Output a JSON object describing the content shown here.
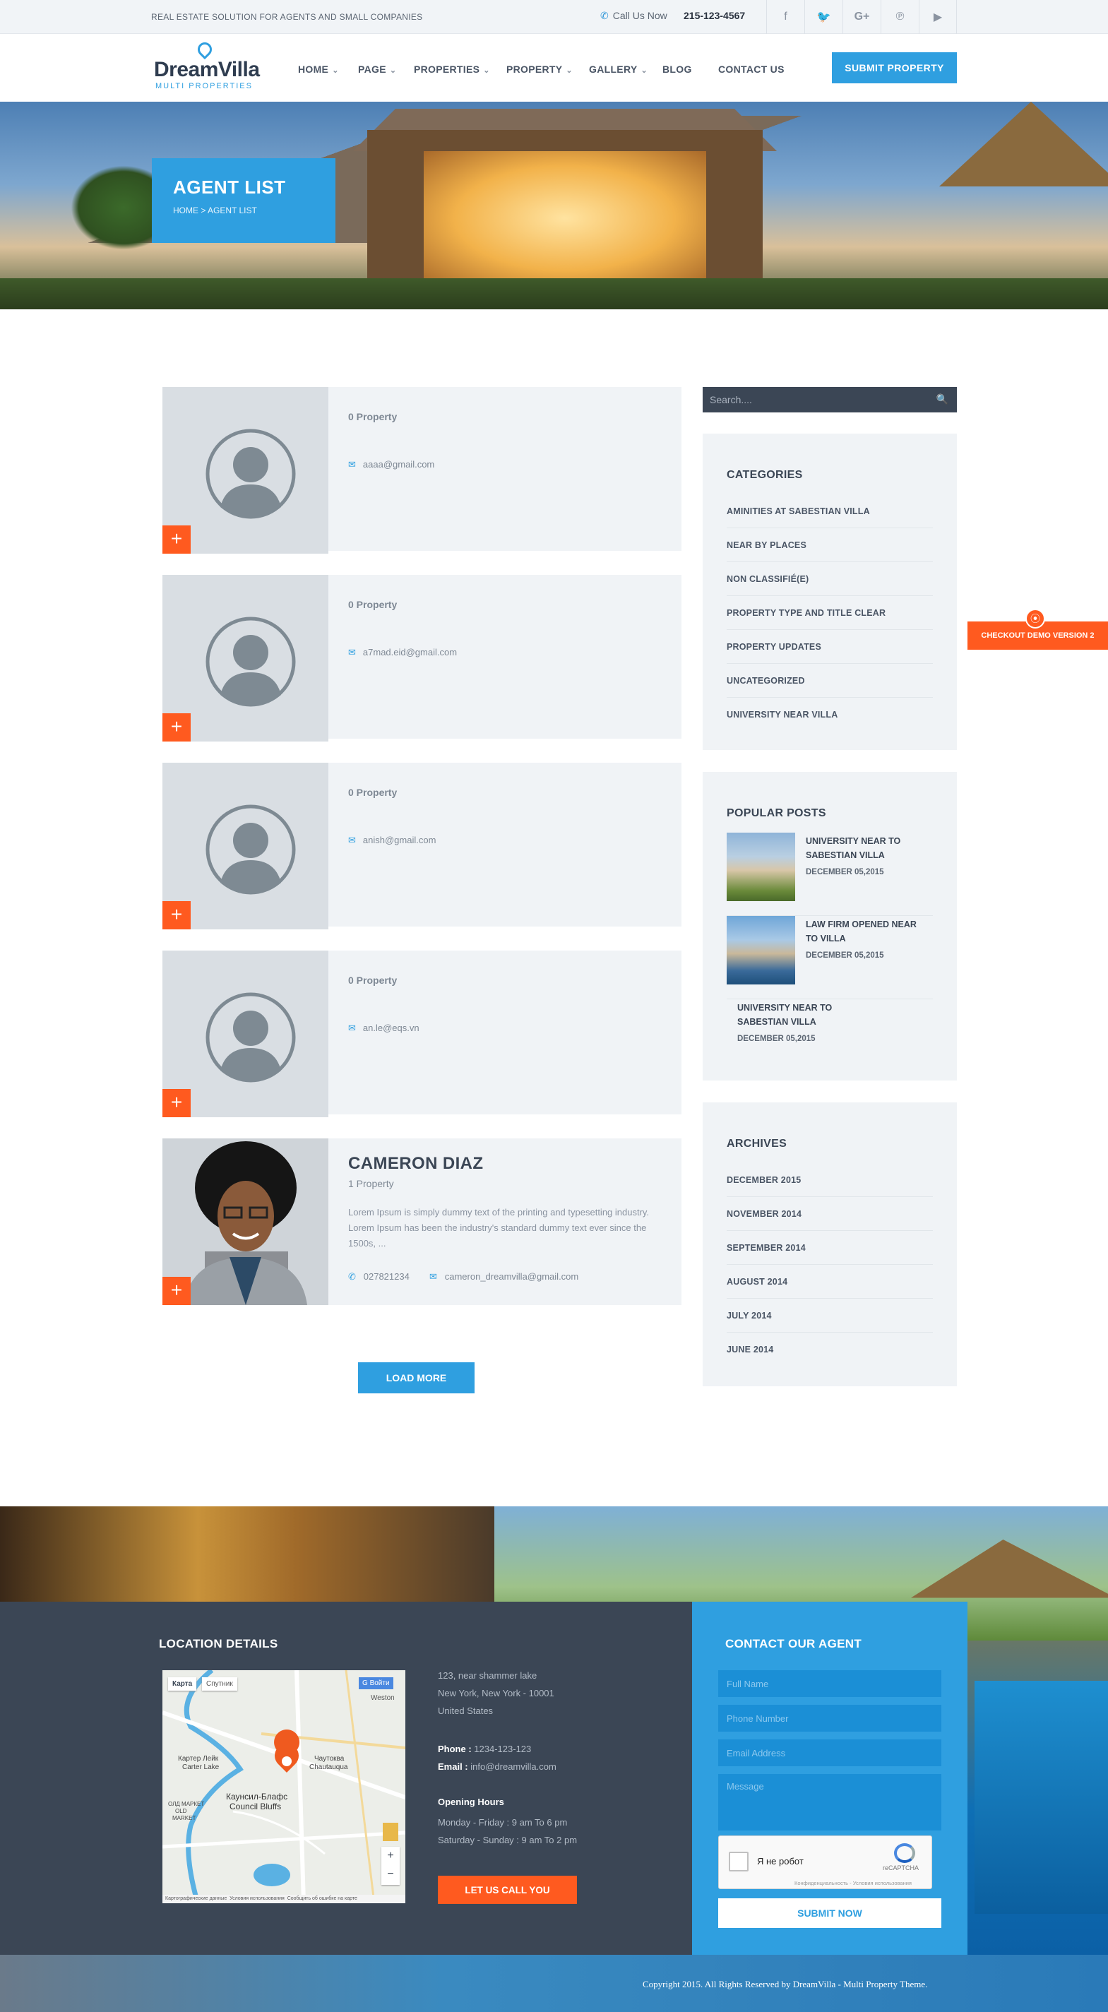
{
  "topbar": {
    "tagline": "REAL ESTATE SOLUTION FOR AGENTS AND SMALL COMPANIES",
    "call_label": "Call Us Now",
    "phone": "215-123-4567",
    "social_icons": [
      "facebook-icon",
      "twitter-icon",
      "google-plus-icon",
      "pinterest-icon",
      "youtube-icon"
    ]
  },
  "brand": {
    "name": "DreamVilla",
    "subtitle": "MULTI PROPERTIES",
    "accent": "#2f9fe0"
  },
  "nav": {
    "items": [
      {
        "label": "HOME",
        "dropdown": true
      },
      {
        "label": "PAGE",
        "dropdown": true
      },
      {
        "label": "PROPERTIES",
        "dropdown": true
      },
      {
        "label": "PROPERTY",
        "dropdown": true
      },
      {
        "label": "GALLERY",
        "dropdown": true
      },
      {
        "label": "BLOG",
        "dropdown": false
      },
      {
        "label": "CONTACT US",
        "dropdown": false
      }
    ],
    "submit_label": "SUBMIT PROPERTY"
  },
  "hero": {
    "title": "AGENT LIST",
    "breadcrumb": "HOME > AGENT LIST"
  },
  "agents": [
    {
      "property": "0 Property",
      "email": "aaaa@gmail.com"
    },
    {
      "property": "0 Property",
      "email": "a7mad.eid@gmail.com"
    },
    {
      "property": "0 Property",
      "email": "anish@gmail.com"
    },
    {
      "property": "0 Property",
      "email": "an.le@eqs.vn"
    }
  ],
  "featured_agent": {
    "name": "CAMERON DIAZ",
    "property": "1 Property",
    "description": "Lorem Ipsum is simply dummy text of the printing and typesetting industry. Lorem Ipsum has been the industry's standard dummy text ever since the 1500s, ...",
    "phone": "027821234",
    "email": "cameron_dreamvilla@gmail.com"
  },
  "load_more_label": "LOAD MORE",
  "sidebar": {
    "search_placeholder": "Search....",
    "categories_title": "CATEGORIES",
    "categories": [
      "AMINITIES AT SABESTIAN VILLA",
      "NEAR BY PLACES",
      "NON CLASSIFIÉ(E)",
      "PROPERTY TYPE AND TITLE CLEAR",
      "PROPERTY UPDATES",
      "UNCATEGORIZED",
      "UNIVERSITY NEAR VILLA"
    ],
    "popular_title": "POPULAR POSTS",
    "posts": [
      {
        "title": "UNIVERSITY NEAR TO SABESTIAN VILLA",
        "date": "DECEMBER 05,2015"
      },
      {
        "title": "LAW FIRM OPENED NEAR TO VILLA",
        "date": "DECEMBER 05,2015"
      },
      {
        "title": "UNIVERSITY NEAR TO SABESTIAN VILLA",
        "date": "DECEMBER 05,2015"
      }
    ],
    "archives_title": "ARCHIVES",
    "archives": [
      "DECEMBER 2015",
      "NOVEMBER 2014",
      "SEPTEMBER 2014",
      "AUGUST 2014",
      "JULY 2014",
      "JUNE 2014"
    ]
  },
  "demo_tag": "CHECKOUT DEMO VERSION 2",
  "footer": {
    "location_title": "LOCATION DETAILS",
    "map": {
      "tab_map": "Карта",
      "tab_sat": "Спутник",
      "signin": "Войти",
      "labels": [
        "Weston",
        "Картер Лейк",
        "Carter Lake",
        "Чаутоква",
        "Chautauqua",
        "Каунсил-Блафс",
        "Council Bluffs",
        "ОЛД МАРКЕТ",
        "OLD",
        "MARKET"
      ],
      "footer_links": [
        "Картографические данные",
        "Условия использования",
        "Сообщить об ошибке на карте"
      ]
    },
    "address": [
      "123, near shammer lake",
      "New York, New York - 10001",
      "United States"
    ],
    "phone_label": "Phone :",
    "phone": "1234-123-123",
    "email_label": "Email :",
    "email": "info@dreamvilla.com",
    "hours_title": "Opening Hours",
    "hours": [
      "Monday - Friday : 9 am To 6 pm",
      "Saturday - Sunday : 9 am To 2 pm"
    ],
    "call_button": "LET US CALL YOU",
    "contact_title": "CONTACT OUR AGENT",
    "form": {
      "name_placeholder": "Full Name",
      "phone_placeholder": "Phone Number",
      "email_placeholder": "Email Address",
      "message_placeholder": "Message",
      "captcha_label": "Я не робот",
      "captcha_brand": "reCAPTCHA",
      "captcha_links": "Конфиденциальность - Условия использования",
      "submit_label": "SUBMIT NOW"
    },
    "copyright": "Copyright 2015. All Rights Reserved by DreamVilla - Multi Property Theme."
  }
}
